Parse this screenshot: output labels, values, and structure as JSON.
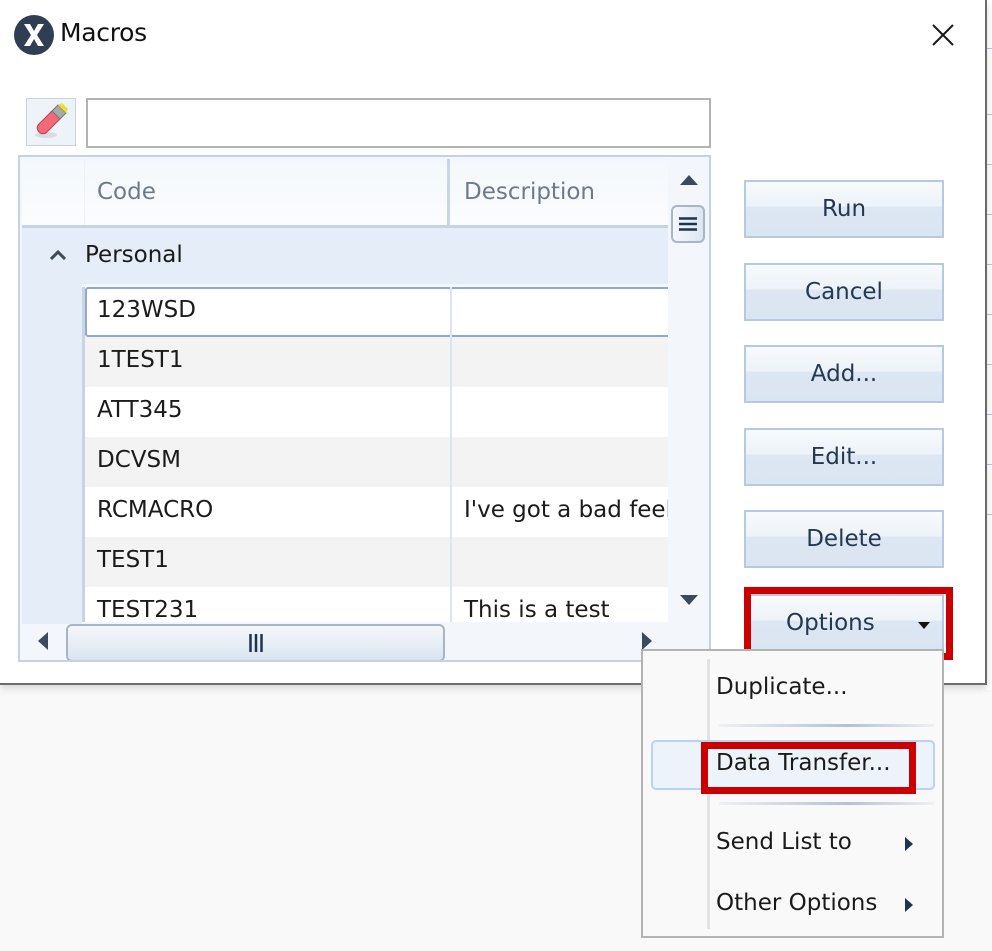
{
  "window": {
    "title": "Macros",
    "app_icon": "x-logo-icon",
    "close_icon": "close-icon"
  },
  "search": {
    "clear_icon": "eraser-icon",
    "value": "",
    "placeholder": ""
  },
  "grid": {
    "columns": [
      "Code",
      "Description"
    ],
    "group": {
      "label": "Personal",
      "expanded": true,
      "rows": [
        {
          "code": "123WSD",
          "description": "",
          "selected": true
        },
        {
          "code": "1TEST1",
          "description": ""
        },
        {
          "code": "ATT345",
          "description": ""
        },
        {
          "code": "DCVSM",
          "description": ""
        },
        {
          "code": "RCMACRO",
          "description": "I've got a bad feel"
        },
        {
          "code": "TEST1",
          "description": ""
        },
        {
          "code": "TEST231",
          "description": "This is a test"
        }
      ]
    }
  },
  "buttons": {
    "run": "Run",
    "cancel": "Cancel",
    "add": "Add...",
    "edit": "Edit...",
    "delete": "Delete",
    "options": "Options"
  },
  "options_menu": {
    "items": [
      {
        "label": "Duplicate...",
        "submenu": false
      },
      {
        "label": "Data Transfer...",
        "submenu": false,
        "hovered": true,
        "highlighted": true
      },
      {
        "label": "Send List to",
        "submenu": true
      },
      {
        "label": "Other Options",
        "submenu": true
      }
    ]
  },
  "colors": {
    "highlight": "#cc0000",
    "title_icon": "#2f3e53",
    "button_text": "#25384f"
  }
}
